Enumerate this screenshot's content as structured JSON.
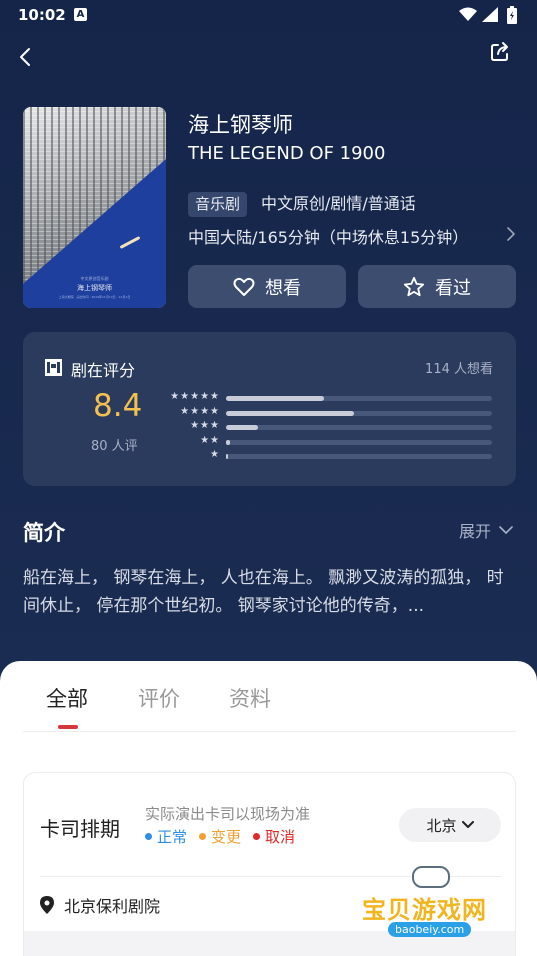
{
  "status_bar": {
    "time": "10:02",
    "notif_badge": "A"
  },
  "show": {
    "title_cn": "海上钢琴师",
    "title_en": "THE LEGEND OF 1900",
    "tag": "音乐剧",
    "genres": "中文原创/剧情/普通话",
    "region_duration": "中国大陆/165分钟（中场休息15分钟）",
    "poster": {
      "title": "海上钢琴师",
      "subtitle": "中文原创音乐剧",
      "footer": "上海大剧院 · 演出时间 · 2019年11月14日 - 12月1日"
    }
  },
  "actions": {
    "want": "想看",
    "seen": "看过"
  },
  "rating": {
    "label": "剧在评分",
    "want_count": "114 人想看",
    "score": "8.4",
    "count": "80 人评",
    "distribution": [
      {
        "stars": "★★★★★",
        "fraction": 0.37
      },
      {
        "stars": "★★★★",
        "fraction": 0.48
      },
      {
        "stars": "★★★",
        "fraction": 0.12
      },
      {
        "stars": "★★",
        "fraction": 0.015
      },
      {
        "stars": "★",
        "fraction": 0.008
      }
    ]
  },
  "intro": {
    "heading": "简介",
    "expand": "展开",
    "text": "船在海上， 钢琴在海上， 人也在海上。 飘渺又波涛的孤独， 时间休止， 停在那个世纪初。 钢琴家讨论他的传奇，..."
  },
  "tabs": [
    {
      "label": "全部"
    },
    {
      "label": "评价"
    },
    {
      "label": "资料"
    }
  ],
  "cast_schedule": {
    "title": "卡司排期",
    "note": "实际演出卡司以现场为准",
    "legend": [
      {
        "label": "正常",
        "color": "#2f8ee6"
      },
      {
        "label": "变更",
        "color": "#f2a033"
      },
      {
        "label": "取消",
        "color": "#e02a2a"
      }
    ],
    "city": "北京",
    "venue": "北京保利剧院"
  },
  "watermark": {
    "text": "宝贝游戏网",
    "url": "baobeiy.com"
  },
  "colors": {
    "accent_score": "#f4c04e",
    "tab_indicator": "#d6373b"
  }
}
